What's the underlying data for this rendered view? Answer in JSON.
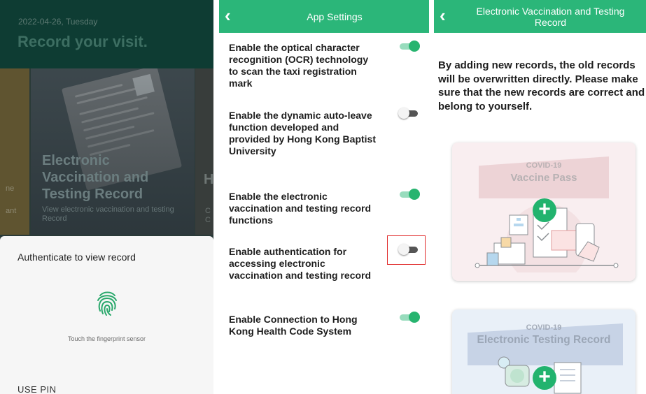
{
  "colors": {
    "accent": "#2bb679",
    "highlight": "#e02929"
  },
  "panel1": {
    "date": "2022-04-26, Tuesday",
    "title": "Record your visit.",
    "left_card_fragment_1": "ne",
    "left_card_fragment_2": "ant",
    "card_title": "Electronic Vaccination and Testing Record",
    "card_subtitle": "View electronic vaccination and testing Record",
    "right_card_fragment_h": "H",
    "right_card_fragment_c1": "C",
    "right_card_fragment_c2": "C",
    "sheet": {
      "title": "Authenticate to view record",
      "icon": "fingerprint-icon",
      "hint": "Touch the fingerprint sensor",
      "pin_label": "USE PIN"
    }
  },
  "panel2": {
    "header_title": "App Settings",
    "back_icon": "chevron-left-icon",
    "settings": [
      {
        "label": "Enable the optical character recognition (OCR) technology to scan the taxi registration mark",
        "state": "on"
      },
      {
        "label": "Enable the dynamic auto-leave function developed and provided by Hong Kong Baptist University",
        "state": "off"
      },
      {
        "label": "Enable the electronic vaccination and testing record functions",
        "state": "on"
      },
      {
        "label": "Enable authentication for accessing electronic vaccination and testing record",
        "state": "off"
      },
      {
        "label": "Enable Connection to Hong Kong Health Code System",
        "state": "on"
      }
    ]
  },
  "panel3": {
    "header_title": "Electronic Vaccination and Testing Record",
    "back_icon": "chevron-left-icon",
    "notice": "By adding new records, the old records will be overwritten directly. Please make sure that the new records are correct and belong to yourself.",
    "cards": [
      {
        "caption_small": "COVID-19",
        "caption_big": "Vaccine Pass",
        "icon": "plus-icon"
      },
      {
        "caption_small": "COVID-19",
        "caption_big": "Electronic Testing Record",
        "icon": "plus-icon"
      }
    ]
  }
}
